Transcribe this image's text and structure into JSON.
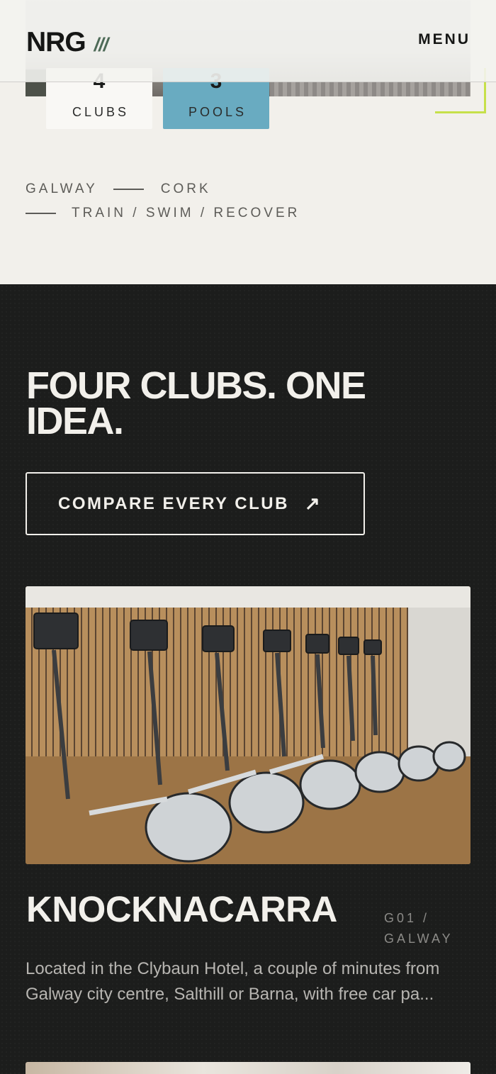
{
  "header": {
    "logo": "NRG",
    "logo_mark": "///",
    "menu_label": "MENU"
  },
  "stats": [
    {
      "value": "4",
      "label": "CLUBS",
      "color": "#f9f8f5"
    },
    {
      "value": "3",
      "label": "POOLS",
      "color": "#69abc1"
    }
  ],
  "locations": {
    "city_1": "GALWAY",
    "city_2": "CORK",
    "tagline": "TRAIN / SWIM / RECOVER"
  },
  "clubs_section": {
    "heading": "FOUR CLUBS. ONE IDEA.",
    "compare_label": "COMPARE EVERY CLUB",
    "compare_icon": "arrow-up-right-icon",
    "background": "#1c1d1c",
    "accent": "#c6e04a"
  },
  "club": {
    "name": "KNOCKNACARRA",
    "code": "G01 / GALWAY",
    "description": "Located in the Clybaun Hotel, a couple of minutes from Galway city centre, Salthill or Barna, with free car pa..."
  }
}
